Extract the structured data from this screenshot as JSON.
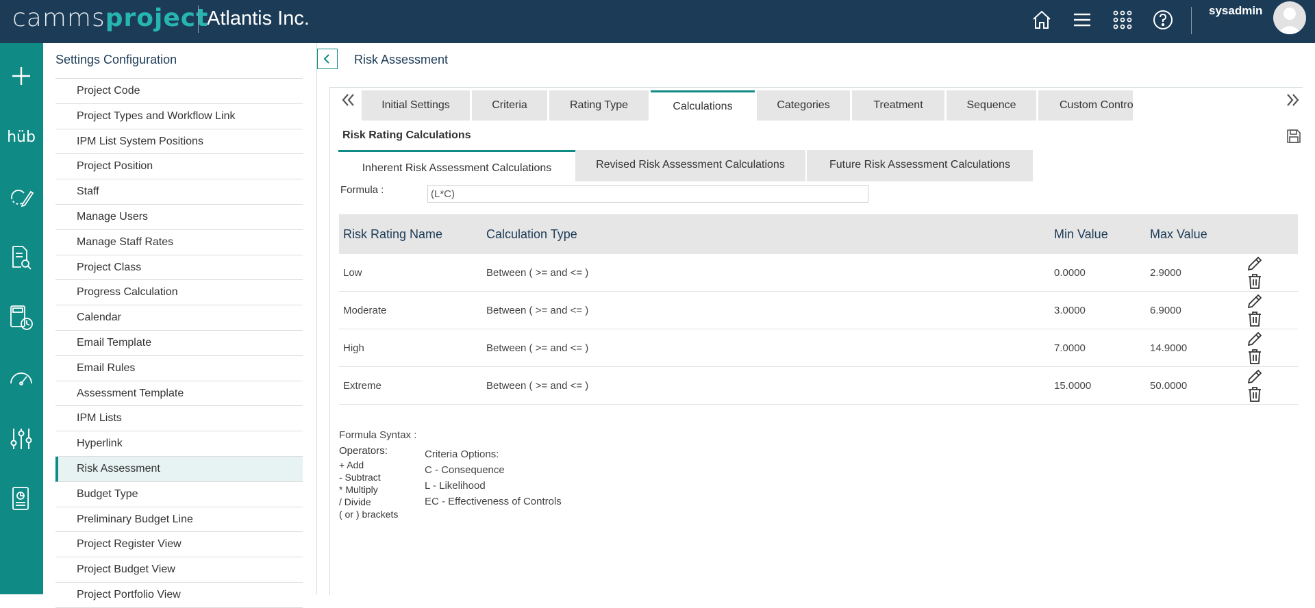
{
  "header": {
    "logo_part1": "camms",
    "logo_part2": "project",
    "company": "Atlantis Inc.",
    "username": "sysadmin",
    "icons": [
      "home-icon",
      "menu-icon",
      "apps-grid-icon",
      "help-icon"
    ]
  },
  "leftnav": {
    "items": [
      "add-icon",
      "hub-icon",
      "tasks-icon",
      "document-search-icon",
      "calculator-clock-icon",
      "gauge-icon",
      "settings-sliders-icon",
      "report-icon"
    ],
    "hub_label": "hüb"
  },
  "settings": {
    "title": "Settings Configuration",
    "items": [
      "Project Code",
      "Project Types and Workflow Link",
      "IPM List System Positions",
      "Project Position",
      "Staff",
      "Manage Users",
      "Manage Staff Rates",
      "Project Class",
      "Progress Calculation",
      "Calendar",
      "Email Template",
      "Email Rules",
      "Assessment Template",
      "IPM Lists",
      "Hyperlink",
      "Risk Assessment",
      "Budget Type",
      "Preliminary Budget Line",
      "Project Register View",
      "Project Budget View",
      "Project Portfolio View"
    ],
    "active": "Risk Assessment"
  },
  "main": {
    "title": "Risk Assessment",
    "tabs": [
      "Initial Settings",
      "Criteria",
      "Rating Type",
      "Calculations",
      "Categories",
      "Treatment",
      "Sequence",
      "Custom Controls"
    ],
    "active_tab": "Calculations",
    "section_title": "Risk Rating Calculations",
    "subtabs": [
      "Inherent Risk Assessment Calculations",
      "Revised Risk Assessment Calculations",
      "Future Risk Assessment Calculations"
    ],
    "formula_label": "Formula :",
    "formula_value": "(L*C)",
    "table": {
      "headers": [
        "Risk Rating Name",
        "Calculation Type",
        "Min Value",
        "Max Value"
      ],
      "rows": [
        {
          "name": "Low",
          "type": "Between ( >= and <= )",
          "min": "0.0000",
          "max": "2.9000"
        },
        {
          "name": "Moderate",
          "type": "Between ( >= and <= )",
          "min": "3.0000",
          "max": "6.9000"
        },
        {
          "name": "High",
          "type": "Between ( >= and <= )",
          "min": "7.0000",
          "max": "14.9000"
        },
        {
          "name": "Extreme",
          "type": "Between ( >= and <= )",
          "min": "15.0000",
          "max": "50.0000"
        }
      ]
    },
    "syntax": {
      "title": "Formula Syntax :",
      "operators_label": "Operators:",
      "operators": [
        "+ Add",
        "- Subtract",
        "* Multiply",
        "/ Divide",
        "( or ) brackets"
      ],
      "criteria_label": "Criteria Options:",
      "criteria": [
        "C - Consequence",
        "L - Likelihood",
        "EC - Effectiveness of Controls"
      ]
    }
  },
  "colors": {
    "topbar": "#1c3b57",
    "accent": "#0f8a85",
    "logo_accent": "#26b5b0"
  }
}
